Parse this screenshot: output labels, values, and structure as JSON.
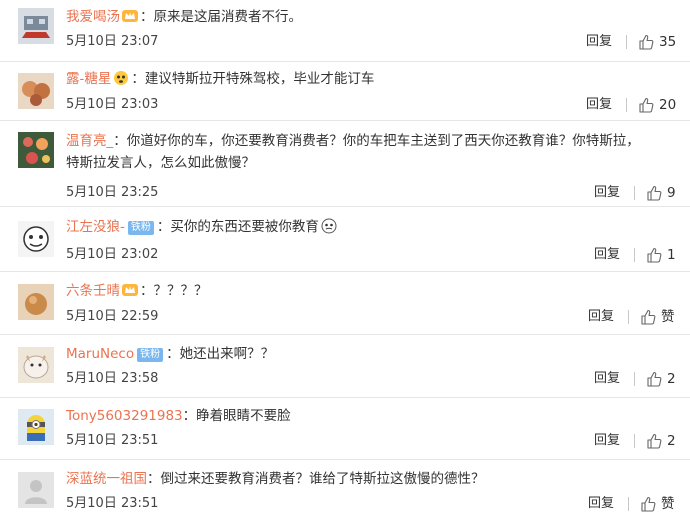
{
  "comments": [
    {
      "user": "我爱喝汤",
      "has_badge": true,
      "text": "原来是这届消费者不行。",
      "time": "5月10日 23:07",
      "reply_label": "回复",
      "likes": "35"
    },
    {
      "user": "露-糖星",
      "has_badge": true,
      "text": "建议特斯拉开特殊驾校，毕业才能订车",
      "time": "5月10日 23:03",
      "reply_label": "回复",
      "likes": "20"
    },
    {
      "user": "温育亮_",
      "text_line1": "你道好你的车，你还要教育消费者？你的车把车主送到了西天你还教育谁？你特斯拉，",
      "text_line2": "特斯拉发言人，怎么如此傲慢？",
      "time": "5月10日 23:25",
      "reply_label": "回复",
      "likes": "9"
    },
    {
      "user": "江左没狼-",
      "fan_badge": "铁粉",
      "text": "买你的东西还要被你教育",
      "time": "5月10日 23:02",
      "reply_label": "回复",
      "likes": "1"
    },
    {
      "user": "六条壬晴",
      "has_badge": true,
      "text": "？？？？",
      "time": "5月10日 22:59",
      "reply_label": "回复",
      "likes": "赞"
    },
    {
      "user": "MaruNeco",
      "fan_badge": "铁粉",
      "text": "她还出来啊？？",
      "time": "5月10日 23:58",
      "reply_label": "回复",
      "likes": "2"
    },
    {
      "user": "Tony5603291983",
      "text": "睁着眼睛不要脸",
      "time": "5月10日 23:51",
      "reply_label": "回复",
      "likes": "2"
    },
    {
      "user": "深蓝统一祖国",
      "text": "倒过来还要教育消费者？谁给了特斯拉这傲慢的德性？",
      "time": "5月10日 23:51",
      "reply_label": "回复",
      "likes": "赞"
    }
  ],
  "colors": {
    "username": "#eb7350",
    "fan_badge_bg": "#7ab7ef",
    "text": "#333333",
    "divider": "#e6e6e6"
  },
  "icons": {
    "like": "thumbs-up-icon",
    "badge": "member-crown-icon"
  }
}
